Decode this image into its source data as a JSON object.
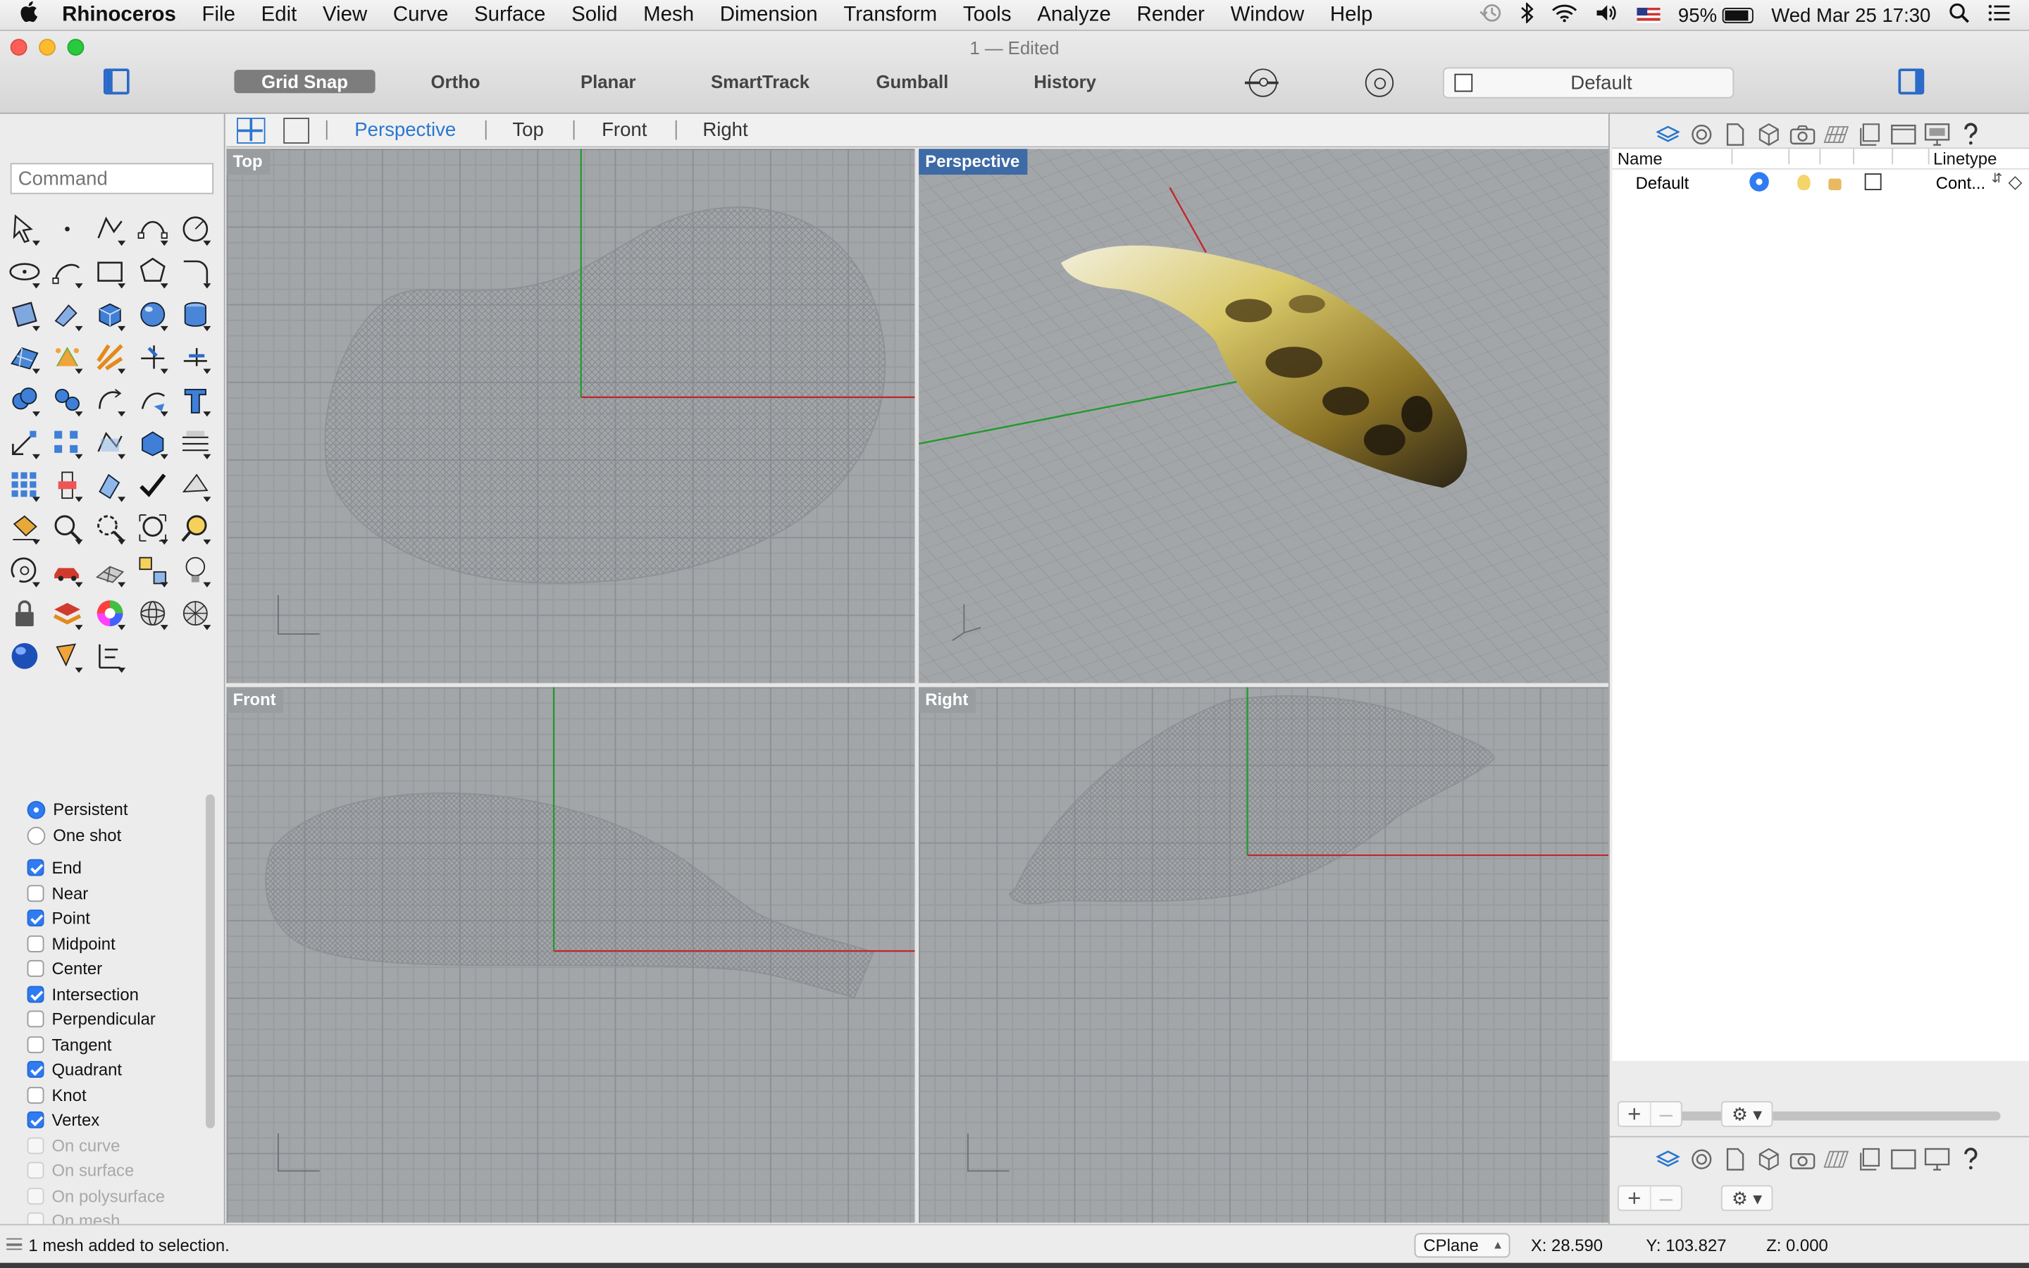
{
  "menubar": {
    "app_name": "Rhinoceros",
    "items": [
      "File",
      "Edit",
      "View",
      "Curve",
      "Surface",
      "Solid",
      "Mesh",
      "Dimension",
      "Transform",
      "Tools",
      "Analyze",
      "Render",
      "Window",
      "Help"
    ],
    "battery": "95%",
    "battery_level": 0.95,
    "clock": "Wed Mar 25  17:30"
  },
  "window": {
    "title": "1 — Edited"
  },
  "toolbar": {
    "modes": [
      {
        "label": "Grid Snap",
        "active": true
      },
      {
        "label": "Ortho",
        "active": false
      },
      {
        "label": "Planar",
        "active": false
      },
      {
        "label": "SmartTrack",
        "active": false
      },
      {
        "label": "Gumball",
        "active": false
      },
      {
        "label": "History",
        "active": false
      }
    ],
    "current_layer": "Default"
  },
  "command": {
    "placeholder": "Command"
  },
  "tools": [
    "select-arrow-icon",
    "point-icon",
    "polyline-icon",
    "curve-icon",
    "circle-icon",
    "ellipse-icon",
    "arc-icon",
    "rectangle-icon",
    "polygon-icon",
    "fillet-icon",
    "surface-corners-icon",
    "extrude-icon",
    "box-icon",
    "sphere-icon",
    "cylinder-icon",
    "surface-network-icon",
    "cage-edit-icon",
    "explode-icon",
    "trim-icon",
    "split-icon",
    "boolean-union-icon",
    "boolean-split-icon",
    "rotate-icon",
    "curve-from-object-icon",
    "text-icon",
    "dimension-icon",
    "array-icon",
    "edit-points-icon",
    "cap-icon",
    "contour-icon",
    "grid-array-icon",
    "join-icon",
    "shell-icon",
    "check-icon",
    "analyze-icon",
    "paint-bucket-icon",
    "zoom-icon",
    "zoom-window-icon",
    "zoom-extents-icon",
    "zoom-selected-icon",
    "rotate-view-icon",
    "car-icon",
    "mesh-icon",
    "snapshot-icon",
    "light-icon",
    "lock-icon",
    "layers-icon",
    "color-wheel-icon",
    "wire-sphere-icon",
    "render-sphere-icon",
    "blue-sphere-icon",
    "pencil-icon",
    "distance-icon"
  ],
  "osnap": {
    "modes": [
      {
        "label": "Persistent",
        "selected": true
      },
      {
        "label": "One shot",
        "selected": false
      }
    ],
    "snaps": [
      {
        "label": "End",
        "checked": true,
        "enabled": true
      },
      {
        "label": "Near",
        "checked": false,
        "enabled": true
      },
      {
        "label": "Point",
        "checked": true,
        "enabled": true
      },
      {
        "label": "Midpoint",
        "checked": false,
        "enabled": true
      },
      {
        "label": "Center",
        "checked": false,
        "enabled": true
      },
      {
        "label": "Intersection",
        "checked": true,
        "enabled": true
      },
      {
        "label": "Perpendicular",
        "checked": false,
        "enabled": true
      },
      {
        "label": "Tangent",
        "checked": false,
        "enabled": true
      },
      {
        "label": "Quadrant",
        "checked": true,
        "enabled": true
      },
      {
        "label": "Knot",
        "checked": false,
        "enabled": true
      },
      {
        "label": "Vertex",
        "checked": true,
        "enabled": true
      },
      {
        "label": "On curve",
        "checked": false,
        "enabled": false
      },
      {
        "label": "On surface",
        "checked": false,
        "enabled": false
      },
      {
        "label": "On polysurface",
        "checked": false,
        "enabled": false
      },
      {
        "label": "On mesh",
        "checked": false,
        "enabled": false
      }
    ]
  },
  "viewport_tabs": [
    "Perspective",
    "Top",
    "Front",
    "Right"
  ],
  "viewports": {
    "top": "Top",
    "perspective": "Perspective",
    "front": "Front",
    "right": "Right"
  },
  "layers_panel": {
    "col_name": "Name",
    "col_linetype": "Linetype",
    "rows": [
      {
        "name": "Default",
        "linetype": "Cont...",
        "current": true
      }
    ]
  },
  "status": {
    "message": "1 mesh added to selection.",
    "cplane": "CPlane",
    "x": "X: 28.590",
    "y": "Y: 103.827",
    "z": "Z: 0.000"
  },
  "colors": {
    "accent": "#2a77cf",
    "active_viewport_label": "#3e6aa6",
    "x_axis": "#c0262d",
    "y_axis": "#1f9a2b"
  }
}
